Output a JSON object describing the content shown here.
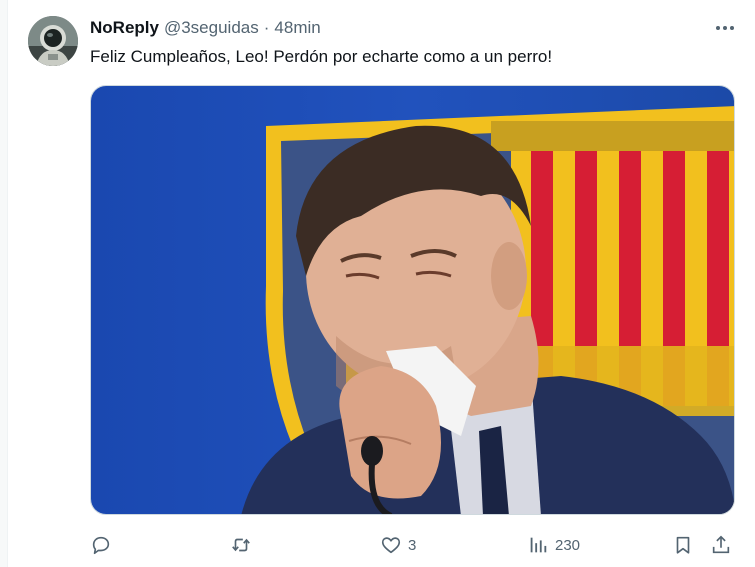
{
  "tweet": {
    "display_name": "NoReply",
    "handle": "@3seguidas",
    "separator": "·",
    "time": "48min",
    "text": "Feliz Cumpleaños, Leo! Perdón por echarte como a un perro!",
    "avatar_icon": "astronaut-avatar",
    "media_alt": "photo"
  },
  "actions": {
    "reply": {
      "icon": "reply-icon",
      "count": ""
    },
    "retweet": {
      "icon": "retweet-icon",
      "count": ""
    },
    "like": {
      "icon": "heart-icon",
      "count": "3"
    },
    "views": {
      "icon": "views-icon",
      "count": "230"
    },
    "bookmark": {
      "icon": "bookmark-icon"
    },
    "share": {
      "icon": "share-icon"
    }
  },
  "colors": {
    "text": "#0f1419",
    "secondary": "#536471",
    "border": "#cfd9de",
    "backdrop_blue": "#1f4fb6",
    "crest_gold": "#f2c01e",
    "crest_red": "#d61e34"
  }
}
